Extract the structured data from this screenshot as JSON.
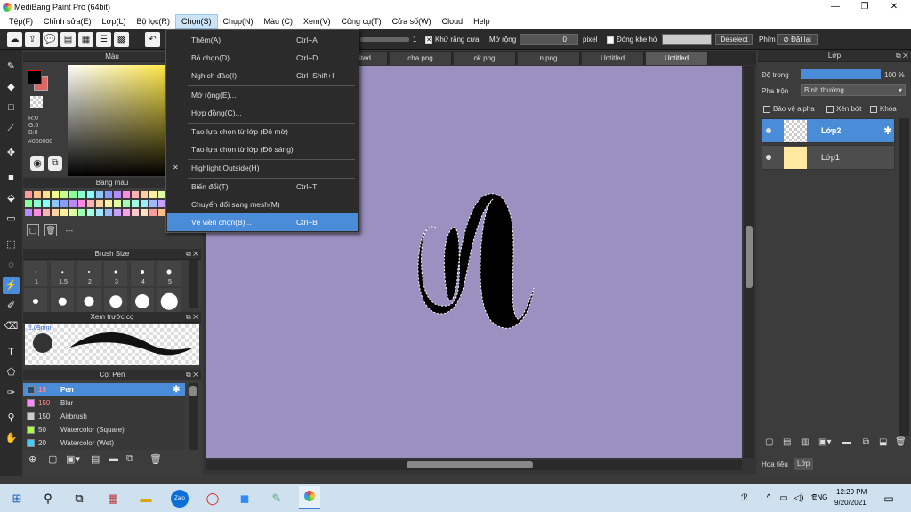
{
  "window": {
    "title": "MediBang Paint Pro (64bit)",
    "min": "—",
    "max": "❐",
    "close": "✕"
  },
  "menu": [
    "Tệp(F)",
    "Chỉnh sửa(E)",
    "Lớp(L)",
    "Bộ lọc(R)",
    "Chọn(S)",
    "Chụp(N)",
    "Màu (C)",
    "Xem(V)",
    "Công cụ(T)",
    "Cửa số(W)",
    "Cloud",
    "Help"
  ],
  "toolbar": {
    "value_one": "1",
    "antialias_label": "Khử răng cưa",
    "expand_label": "Mở rộng",
    "expand_value": "0",
    "pixel_label": "pixel",
    "gap_label": "Đóng khe hở",
    "deselect_label": "Deselect",
    "shortcut_label": "Phím",
    "reset_label": "Đặt lại"
  },
  "select_menu": {
    "items": [
      {
        "label": "Thêm(A)",
        "shortcut": "Ctrl+A"
      },
      {
        "label": "Bỏ chọn(D)",
        "shortcut": "Ctrl+D"
      },
      {
        "label": "Nghịch đảo(I)",
        "shortcut": "Ctrl+Shift+I"
      },
      {
        "label": "Mở rộng(E)...",
        "shortcut": ""
      },
      {
        "label": "Hợp đồng(C)...",
        "shortcut": ""
      },
      {
        "label": "Tạo lựa chọn từ lớp (Độ mờ)",
        "shortcut": ""
      },
      {
        "label": "Tạo lựa chọn từ lớp (Độ sáng)",
        "shortcut": ""
      },
      {
        "label": "Highlight Outside(H)",
        "shortcut": "",
        "checked": true
      },
      {
        "label": "Biến đổi(T)",
        "shortcut": "Ctrl+T"
      },
      {
        "label": "Chuyển đổi sang mesh(M)",
        "shortcut": ""
      },
      {
        "label": "Vẽ viền chọn(B)...",
        "shortcut": "Ctrl+B",
        "highlighted": true
      }
    ]
  },
  "color_panel": {
    "title": "Màu",
    "r": "R:0",
    "g": "G:0",
    "b": "B:0",
    "hex": "#000000"
  },
  "palette_panel": {
    "title": "Bảng màu",
    "add_label": "---"
  },
  "brush_size_panel": {
    "title": "Brush Size",
    "sizes": [
      "1",
      "1.5",
      "2",
      "3",
      "4",
      "5"
    ]
  },
  "preview_panel": {
    "title": "Xem trước cọ",
    "size_label": "1.09mm"
  },
  "brush_panel": {
    "title": "Cọ: Pen",
    "brushes": [
      {
        "size": "15",
        "name": "Pen",
        "color": "#2a4a6a",
        "selected": true
      },
      {
        "size": "150",
        "name": "Blur",
        "color": "#ff88ff"
      },
      {
        "size": "150",
        "name": "Airbrush",
        "color": "#cccccc"
      },
      {
        "size": "50",
        "name": "Watercolor (Square)",
        "color": "#aaff44"
      },
      {
        "size": "20",
        "name": "Watercolor (Wet)",
        "color": "#44ccff"
      }
    ]
  },
  "tabs": [
    "ited",
    "cha.png",
    "ok.png",
    "n.png",
    "Untitled",
    "Untitled"
  ],
  "layer_panel": {
    "title": "Lớp",
    "opacity_label": "Độ trong",
    "opacity_value": "100 %",
    "blend_label": "Pha trộn",
    "blend_value": "Bình thường",
    "protect_alpha": "Bảo vệ alpha",
    "clipping": "Xén bớt",
    "lock": "Khóa",
    "layers": [
      {
        "name": "Lớp2",
        "selected": true
      },
      {
        "name": "Lớp1",
        "selected": false
      }
    ],
    "bottom_tabs": [
      "Hoa tiêu",
      "Lớp"
    ]
  },
  "taskbar": {
    "lang": "ENG",
    "time": "12:29 PM",
    "date": "9/20/2021",
    "zalo": "Zalo"
  },
  "colors": {
    "canvas": "#9b90c0",
    "accent": "#4a8cd8"
  }
}
